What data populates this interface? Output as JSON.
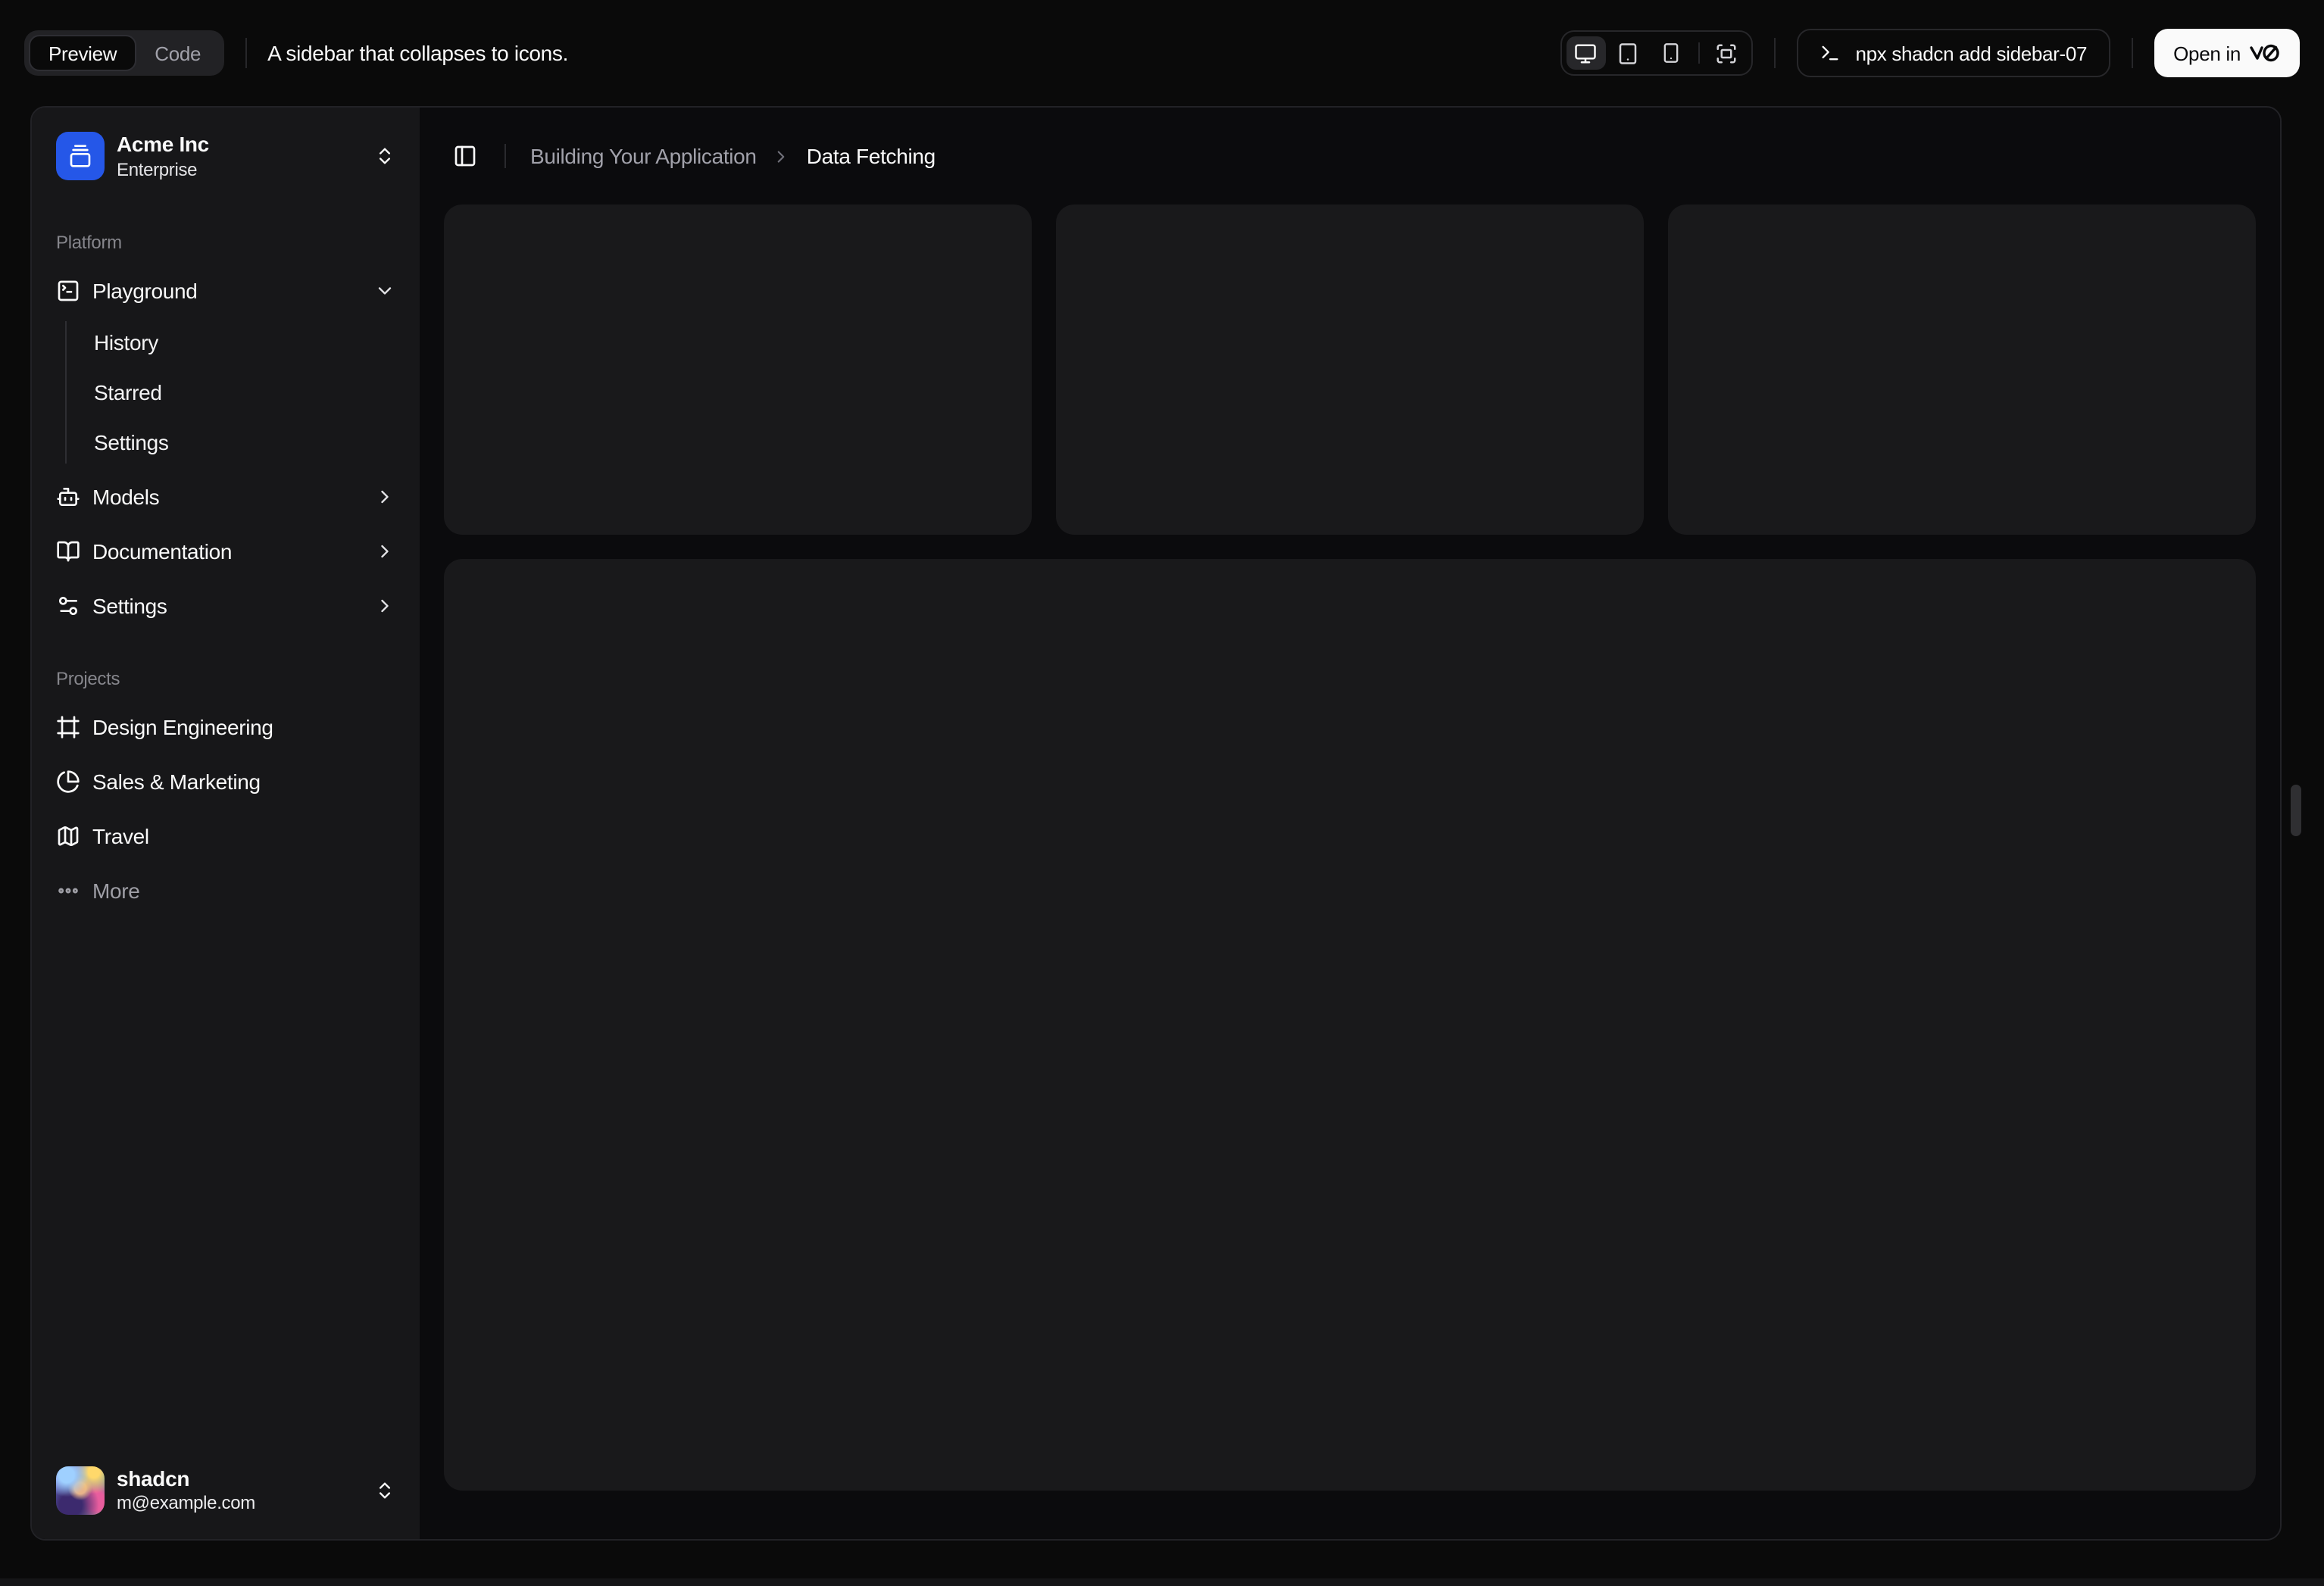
{
  "toolbar": {
    "tabs": {
      "preview": "Preview",
      "code": "Code"
    },
    "description": "A sidebar that collapses to icons.",
    "device_toggles": [
      "desktop",
      "tablet",
      "smartphone",
      "fullscreen"
    ],
    "active_device": "desktop",
    "command": "npx shadcn add sidebar-07",
    "open_button": {
      "label": "Open in",
      "brand": "v0"
    }
  },
  "sidebar": {
    "team": {
      "name": "Acme Inc",
      "plan": "Enterprise",
      "logo_icon": "gallery-vertical-end"
    },
    "groups": [
      {
        "label": "Platform",
        "items": [
          {
            "label": "Playground",
            "icon": "square-terminal",
            "expanded": true,
            "children": [
              "History",
              "Starred",
              "Settings"
            ]
          },
          {
            "label": "Models",
            "icon": "bot"
          },
          {
            "label": "Documentation",
            "icon": "book-open"
          },
          {
            "label": "Settings",
            "icon": "settings-2"
          }
        ]
      },
      {
        "label": "Projects",
        "items": [
          {
            "label": "Design Engineering",
            "icon": "frame"
          },
          {
            "label": "Sales & Marketing",
            "icon": "pie-chart"
          },
          {
            "label": "Travel",
            "icon": "map"
          },
          {
            "label": "More",
            "icon": "ellipsis",
            "muted": true
          }
        ]
      }
    ],
    "user": {
      "name": "shadcn",
      "email": "m@example.com"
    }
  },
  "main": {
    "breadcrumb": {
      "parent": "Building Your Application",
      "current": "Data Fetching"
    },
    "placeholder_cards": 3,
    "big_card": 1
  },
  "colors": {
    "page_bg": "#0a0a0a",
    "sidebar_bg": "#171719",
    "main_bg": "#0b0b0d",
    "card_bg": "#19191b",
    "accent_blue": "#2557e8",
    "text_primary": "#fafafa",
    "text_muted": "#a1a1aa",
    "border": "#27272a"
  }
}
